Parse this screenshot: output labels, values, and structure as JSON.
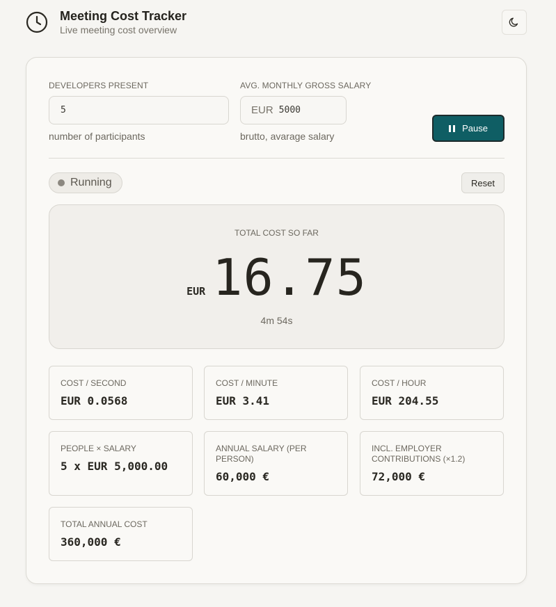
{
  "header": {
    "title": "Meeting Cost Tracker",
    "subtitle": "Live meeting cost overview",
    "clock_icon": "clock-icon",
    "theme_icon": "moon-icon"
  },
  "form": {
    "developers": {
      "label": "DEVELOPERS PRESENT",
      "value": "5",
      "helper": "number of participants"
    },
    "salary": {
      "label": "AVG. MONTHLY GROSS SALARY",
      "currency": "EUR",
      "value": "5000",
      "helper": "brutto, avarage salary"
    },
    "pause_label": "Pause"
  },
  "status": {
    "label": "Running",
    "reset_label": "Reset"
  },
  "total": {
    "label": "TOTAL COST SO FAR",
    "currency": "EUR",
    "value": "16.75",
    "elapsed": "4m 54s"
  },
  "stats": [
    {
      "label": "COST / SECOND",
      "value": "EUR 0.0568"
    },
    {
      "label": "COST / MINUTE",
      "value": "EUR 3.41"
    },
    {
      "label": "COST / HOUR",
      "value": "EUR 204.55"
    },
    {
      "label": "PEOPLE × SALARY",
      "value": "5 x EUR 5,000.00"
    },
    {
      "label": "ANNUAL SALARY (PER PERSON)",
      "value": "60,000 €"
    },
    {
      "label": "INCL. EMPLOYER CONTRIBUTIONS (×1.2)",
      "value": "72,000 €"
    },
    {
      "label": "TOTAL ANNUAL COST",
      "value": "360,000 €"
    }
  ],
  "colors": {
    "accent": "#0f5e64",
    "background": "#f6f5f2",
    "card": "#faf9f6"
  }
}
